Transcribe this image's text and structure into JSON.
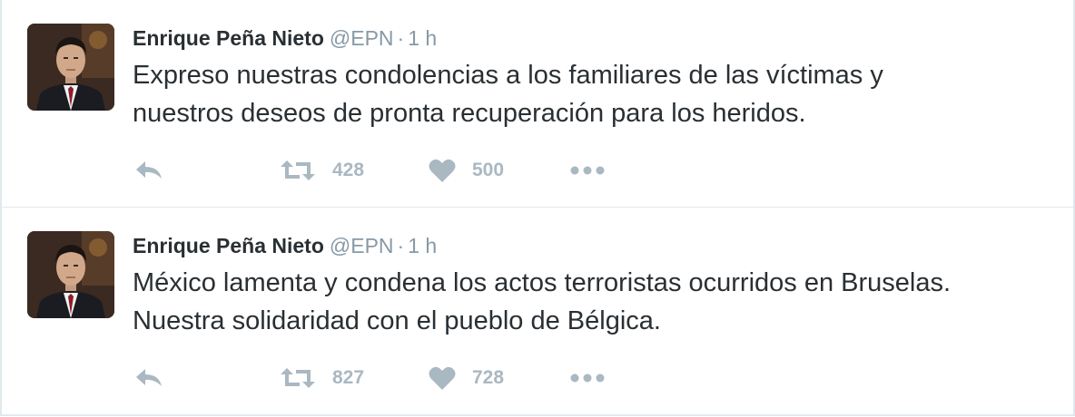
{
  "colors": {
    "border": "#e1e8ed",
    "text": "#292f33",
    "secondary": "#8899a6",
    "action_icon": "#aab8c2"
  },
  "tweets": [
    {
      "author": {
        "name": "Enrique Peña Nieto",
        "handle": "@EPN",
        "separator": "·",
        "time": "1 h"
      },
      "text_lines": [
        "Expreso nuestras condolencias a los familiares de las víctimas y",
        "nuestros deseos de pronta recuperación para los heridos."
      ],
      "icons": {
        "reply": "reply-icon",
        "retweet": "retweet-icon",
        "like": "heart-icon",
        "more": "more-dots-icon"
      },
      "retweets": "428",
      "likes": "500"
    },
    {
      "author": {
        "name": "Enrique Peña Nieto",
        "handle": "@EPN",
        "separator": "·",
        "time": "1 h"
      },
      "text_lines": [
        "México lamenta y condena los actos terroristas ocurridos en Bruselas.",
        "Nuestra solidaridad con el pueblo de Bélgica."
      ],
      "icons": {
        "reply": "reply-icon",
        "retweet": "retweet-icon",
        "like": "heart-icon",
        "more": "more-dots-icon"
      },
      "retweets": "827",
      "likes": "728"
    }
  ]
}
